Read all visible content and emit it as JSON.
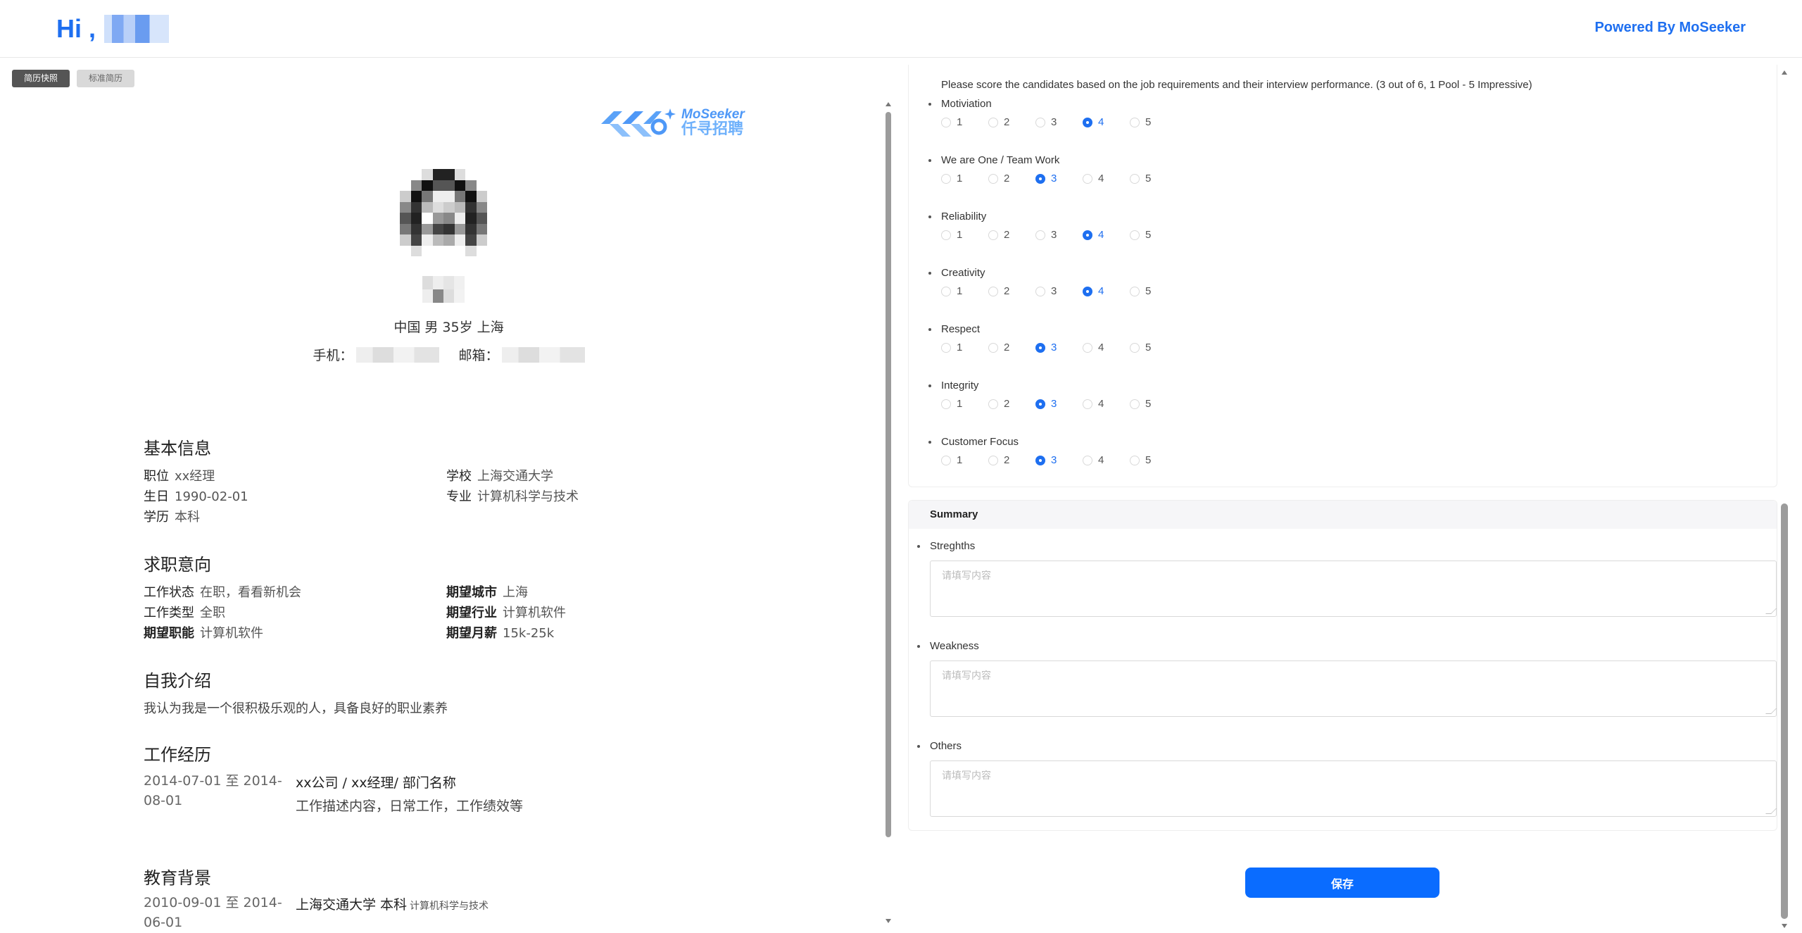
{
  "header": {
    "greeting": "Hi ,",
    "powered_by": "Powered By MoSeeker"
  },
  "resume": {
    "tabs": [
      {
        "label": "简历快照",
        "active": true
      },
      {
        "label": "标准简历",
        "active": false
      }
    ],
    "logo": {
      "en": "MoSeeker",
      "cn": "仟寻招聘"
    },
    "basic_line": "中国 男 35岁 上海",
    "contact": {
      "phone_label": "手机：",
      "email_label": "邮箱："
    },
    "sections": {
      "basic_info": {
        "title": "基本信息",
        "position": {
          "k": "职位",
          "v": "xx经理"
        },
        "school": {
          "k": "学校",
          "v": "上海交通大学"
        },
        "birthday": {
          "k": "生日",
          "v": "1990-02-01"
        },
        "major": {
          "k": "专业",
          "v": "计算机科学与技术"
        },
        "education": {
          "k": "学历",
          "v": "本科"
        }
      },
      "intention": {
        "title": "求职意向",
        "status": {
          "k": "工作状态",
          "v": "在职，看看新机会"
        },
        "city": {
          "k": "期望城市",
          "v": "上海"
        },
        "type": {
          "k": "工作类型",
          "v": "全职"
        },
        "industry": {
          "k": "期望行业",
          "v": "计算机软件"
        },
        "function": {
          "k": "期望职能",
          "v": "计算机软件"
        },
        "salary": {
          "k": "期望月薪",
          "v": "15k-25k"
        }
      },
      "self_intro": {
        "title": "自我介绍",
        "text": "我认为我是一个很积极乐观的人，具备良好的职业素养"
      },
      "work": {
        "title": "工作经历",
        "date": "2014-07-01 至 2014-08-01",
        "role": "xx公司 / xx经理/ 部门名称",
        "desc": "工作描述内容，日常工作，工作绩效等"
      },
      "education_bg": {
        "title": "教育背景",
        "date": "2010-09-01 至 2014-06-01",
        "school": "上海交通大学 本科",
        "major": "计算机科学与技术"
      }
    }
  },
  "evaluation": {
    "intro": "Please score the candidates based on the job requirements and their interview performance. (3 out of 6, 1 Pool - 5 Impressive)",
    "options": [
      "1",
      "2",
      "3",
      "4",
      "5"
    ],
    "criteria": [
      {
        "label": "Motiviation",
        "selected": 4
      },
      {
        "label": "We are One / Team Work",
        "selected": 3
      },
      {
        "label": "Reliability",
        "selected": 4
      },
      {
        "label": "Creativity",
        "selected": 4
      },
      {
        "label": "Respect",
        "selected": 3
      },
      {
        "label": "Integrity",
        "selected": 3
      },
      {
        "label": "Customer Focus",
        "selected": 3
      }
    ],
    "summary": {
      "title": "Summary",
      "fields": [
        {
          "label": "Streghths",
          "placeholder": "请填写内容"
        },
        {
          "label": "Weakness",
          "placeholder": "请填写内容"
        },
        {
          "label": "Others",
          "placeholder": "请填写内容"
        }
      ]
    },
    "save_label": "保存"
  },
  "colors": {
    "accent": "#1e6ff0",
    "button": "#0a6cff"
  }
}
